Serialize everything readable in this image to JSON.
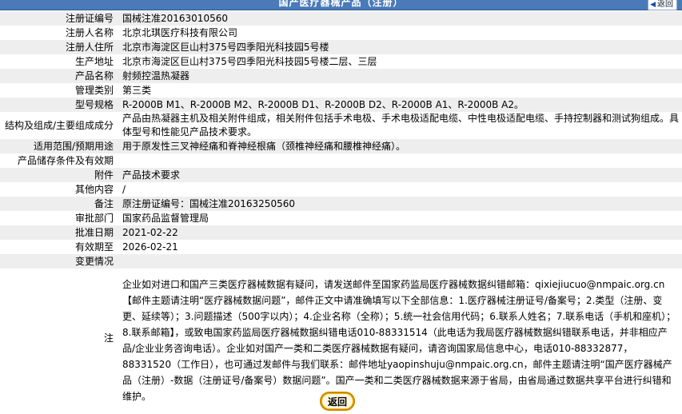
{
  "header": {
    "title": "国产医疗器械产品（注册）",
    "back_label": "返回"
  },
  "rows": [
    {
      "label": "注册证编号",
      "value": "国械注准20163010560"
    },
    {
      "label": "注册人名称",
      "value": "北京北琪医疗科技有限公司"
    },
    {
      "label": "注册人住所",
      "value": "北京市海淀区巨山村375号四季阳光科技园5号楼"
    },
    {
      "label": "生产地址",
      "value": "北京市海淀区巨山村375号四季阳光科技园5号楼二层、三层"
    },
    {
      "label": "产品名称",
      "value": "射频控温热凝器"
    },
    {
      "label": "管理类别",
      "value": "第三类"
    },
    {
      "label": "型号规格",
      "value": "R-2000B M1、R-2000B M2、R-2000B D1、R-2000B D2、R-2000B A1、R-2000B A2。"
    },
    {
      "label": "结构及组成/主要组成成分",
      "value": "产品由热凝器主机及相关附件组成，相关附件包括手术电极、手术电极适配电缆、中性电极适配电缆、手持控制器和测试狗组成。具体型号和性能见产品技术要求。"
    },
    {
      "label": "适用范围/预期用途",
      "value": "用于原发性三叉神经痛和脊神经根痛（颈椎神经痛和腰椎神经痛）。"
    },
    {
      "label": "产品储存条件及有效期",
      "value": ""
    },
    {
      "label": "附件",
      "value": "产品技术要求"
    },
    {
      "label": "其他内容",
      "value": "/"
    },
    {
      "label": "备注",
      "value": "原注册证编号：国械注准20163250560"
    },
    {
      "label": "审批部门",
      "value": "国家药品监督管理局"
    },
    {
      "label": "批准日期",
      "value": "2021-02-22"
    },
    {
      "label": "有效期至",
      "value": "2026-02-21"
    },
    {
      "label": "变更情况",
      "value": ""
    }
  ],
  "note": {
    "label": "注",
    "text": "企业如对进口和国产三类医疗器械数据有疑问，请发送邮件至国家药监局医疗器械数据纠错邮箱：qixiejiucuo@nmpaic.org.cn【邮件主题请注明“医疗器械数据问题”，邮件正文中请准确填写以下全部信息：1.医疗器械注册证号/备案号；2.类型（注册、变更、延续等）；3.问题描述（500字以内）；4.企业名称（全称）；5.统一社会信用代码；6.联系人姓名；7.联系电话（手机和座机）；8.联系邮箱】，或致电国家药监局医疗器械数据纠错电话010-88331514（此电话为我局医疗器械数据纠错联系电话，并非相应产品/企业业务咨询电话）。企业如对国产一类和二类医疗器械数据有疑问，请咨询国家局信息中心，电话010-88332877，88331520（工作日），也可通过发邮件与我们联系：邮件地址yaopinshuju@nmpaic.org.cn，邮件主题请注明“国产医疗器械产品（注册）-数据（注册证号/备案号）数据问题”。国产一类和二类医疗器械数据来源于省局，由省局通过数据共享平台进行纠错和维护。"
  },
  "footer": {
    "back_label": "返回"
  }
}
